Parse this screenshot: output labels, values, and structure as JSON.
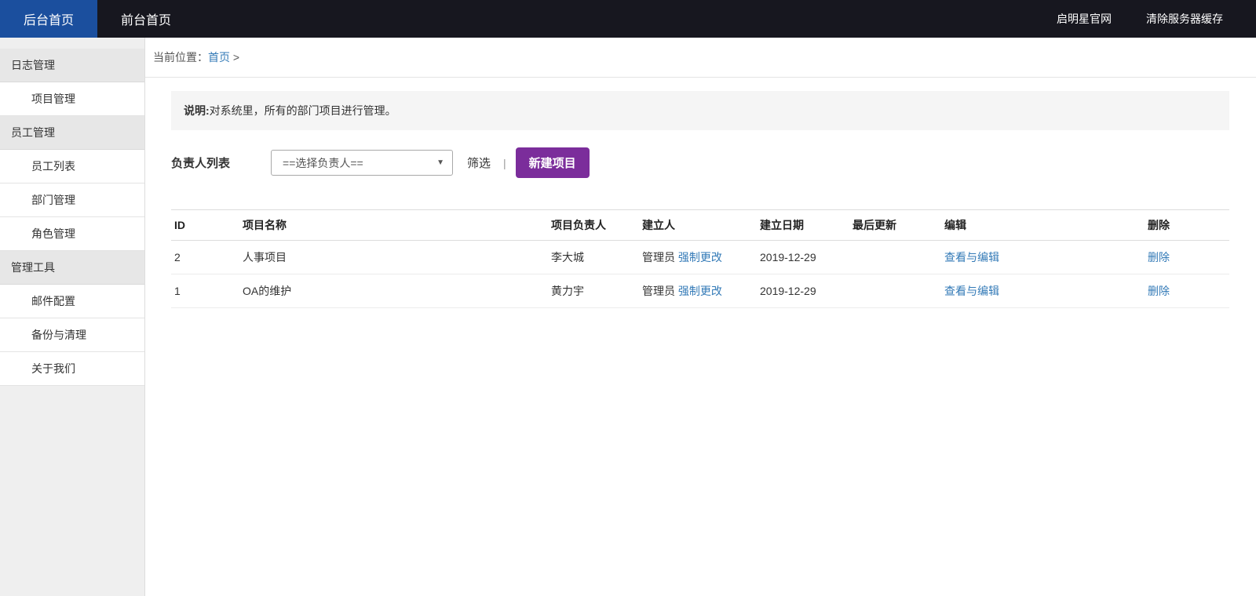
{
  "colors": {
    "topbar_bg": "#17171f",
    "active_tab_bg": "#1b4f9e",
    "link_blue": "#337ab7",
    "button_purple": "#7b2d9b",
    "note_bg": "#f5f5f5"
  },
  "topbar": {
    "tabs": [
      {
        "label": "后台首页"
      },
      {
        "label": "前台首页"
      }
    ],
    "links": [
      {
        "label": "启明星官网"
      },
      {
        "label": "清除服务器缓存"
      }
    ]
  },
  "sidebar": {
    "groups": [
      {
        "header": "日志管理",
        "items": [
          "项目管理"
        ]
      },
      {
        "header": "员工管理",
        "items": [
          "员工列表",
          "部门管理",
          "角色管理"
        ]
      },
      {
        "header": "管理工具",
        "items": [
          "邮件配置",
          "备份与清理",
          "关于我们"
        ]
      }
    ]
  },
  "breadcrumb": {
    "prefix": "当前位置：",
    "home": "首页",
    "arrow": ">"
  },
  "note": {
    "label": "说明:",
    "text": "对系统里，所有的部门项目进行管理。"
  },
  "filter": {
    "label": "负责人列表",
    "select_value": "==选择负责人==",
    "caret": "▼",
    "filter_label": "筛选",
    "divider": "|",
    "new_button": "新建项目"
  },
  "table": {
    "headers": [
      "ID",
      "项目名称",
      "项目负责人",
      "建立人",
      "建立日期",
      "最后更新",
      "编辑",
      "删除"
    ],
    "rows": [
      {
        "id": "2",
        "name": "人事项目",
        "owner": "李大城",
        "creator": "管理员",
        "force_change": "强制更改",
        "date": "2019-12-29",
        "last_update": "",
        "edit": "查看与编辑",
        "delete": "删除"
      },
      {
        "id": "1",
        "name": "OA的维护",
        "owner": "黄力宇",
        "creator": "管理员",
        "force_change": "强制更改",
        "date": "2019-12-29",
        "last_update": "",
        "edit": "查看与编辑",
        "delete": "删除"
      }
    ]
  }
}
